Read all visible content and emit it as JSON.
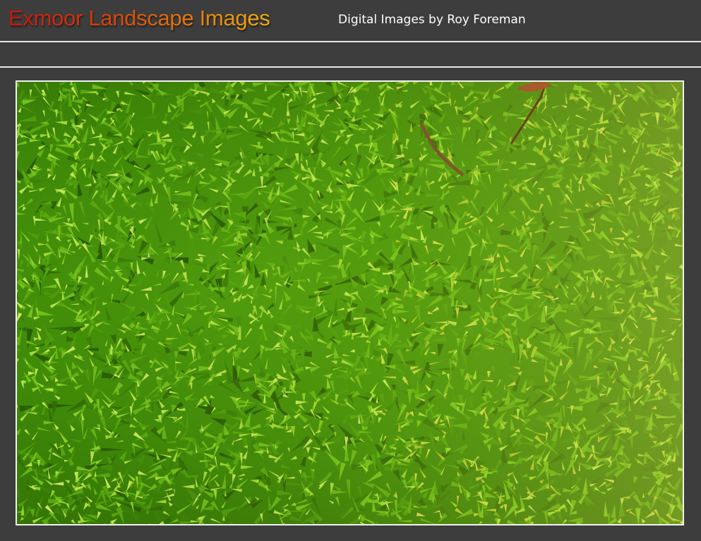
{
  "header": {
    "title": "Exmoor Landscape Images",
    "subtitle": "Digital Images by Roy Foreman"
  },
  "photo": {
    "subject": "moss-photo"
  },
  "colors": {
    "background": "#3d3d3d",
    "divider": "#e8e8e8",
    "title_gradient_start": "#c2180c",
    "title_gradient_end": "#f0ad12",
    "moss_dark": "#2f6b06",
    "moss_mid": "#5fae12",
    "moss_light": "#b6dc3a"
  }
}
